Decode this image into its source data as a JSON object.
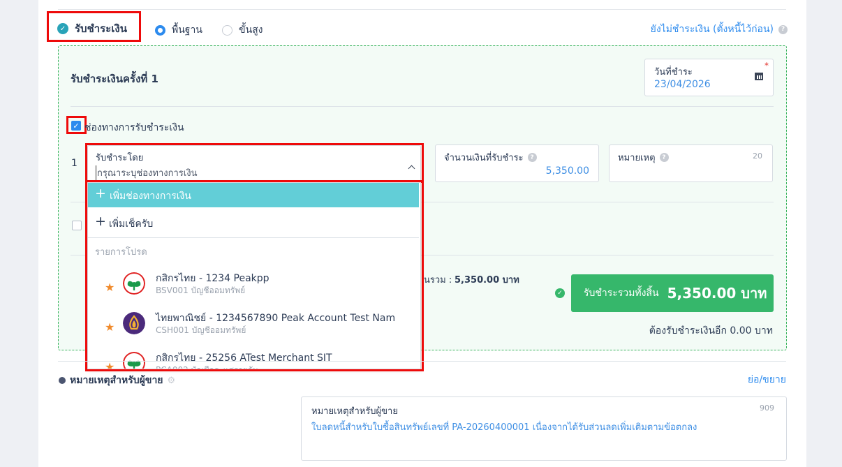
{
  "payment": {
    "receive_label": "รับชำระเงิน",
    "mode_basic": "พื้นฐาน",
    "mode_advanced": "ขั้นสูง",
    "defer_link": "ยังไม่ชำระเงิน (ตั้งหนี้ไว้ก่อน)",
    "section_title": "รับชำระเงินครั้งที่ 1",
    "date_label": "วันที่ชำระ",
    "date_value": "23/04/2026",
    "channel_checkbox_label": "ช่องทางการรับชำระเงิน",
    "row_number": "1",
    "pay_by_label": "รับชำระโดย",
    "pay_by_placeholder": "กรุณาระบุช่องทางการเงิน",
    "amount_label": "จำนวนเงินที่รับชำระ",
    "amount_value": "5,350.00",
    "note_label": "หมายเหตุ",
    "note_counter": "20",
    "total_label_fragment": "นรวม :",
    "total_value": "5,350.00 บาท",
    "total_button_label": "รับชำระรวมทั้งสิ้น",
    "total_button_amount": "5,350.00 บาท",
    "remaining_text": "ต้องรับชำระเงินอีก 0.00 บาท"
  },
  "dropdown": {
    "add_channel": "เพิ่มช่องทางการเงิน",
    "add_cheque": "เพิ่มเช็ครับ",
    "favorites_header": "รายการโปรด",
    "items": [
      {
        "title": "กสิกรไทย - 1234 Peakpp",
        "subtitle": "BSV001 บัญชีออมทรัพย์"
      },
      {
        "title": "ไทยพาณิชย์ - 1234567890 Peak Account Test Nam",
        "subtitle": "CSH001 บัญชีออมทรัพย์"
      },
      {
        "title": "กสิกรไทย - 25256 ATest Merchant SIT",
        "subtitle": "PCA002 บัญชีกระแสรายวัน"
      }
    ]
  },
  "seller_note": {
    "heading": "หมายเหตุสำหรับผู้ขาย",
    "toggle_link": "ย่อ/ขยาย",
    "field_label": "หมายเหตุสำหรับผู้ขาย",
    "counter": "909",
    "text": "ใบลดหนี้สำหรับใบซื้อสินทรัพย์เลขที่ PA-20260400001 เนื่องจากได้รับส่วนลดเพิ่มเติมตามข้อตกลง"
  },
  "colors": {
    "accent_blue": "#2d8bee",
    "green": "#36b76b",
    "teal_highlight": "#62ced7",
    "red_annotation": "#ee0a0a"
  }
}
